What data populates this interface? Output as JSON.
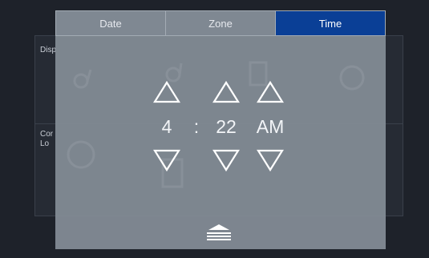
{
  "background": {
    "label_display": "Disp",
    "label_control_line1": "Cor",
    "label_control_line2": "Lo"
  },
  "tabs": [
    {
      "label": "Date",
      "active": false
    },
    {
      "label": "Zone",
      "active": false
    },
    {
      "label": "Time",
      "active": true
    }
  ],
  "time": {
    "hour": "4",
    "separator": ":",
    "minute": "22",
    "meridiem": "AM"
  },
  "icons": {
    "up": "triangle-up-icon",
    "down": "triangle-down-icon",
    "collapse": "eject-collapse-icon"
  },
  "colors": {
    "active_tab": "#0a3f96",
    "modal_bg": "#848d97",
    "screen_bg": "#1e222a"
  }
}
